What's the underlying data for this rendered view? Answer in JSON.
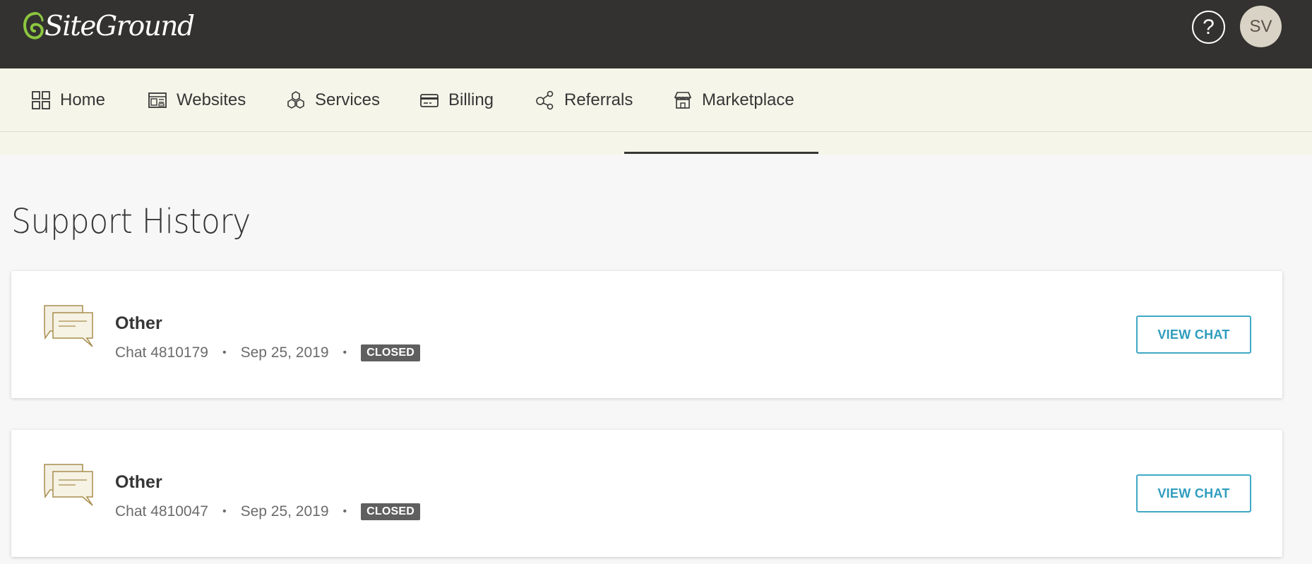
{
  "header": {
    "logo_text": "SiteGround",
    "help_icon": "question-circle-icon",
    "help_label": "?",
    "avatar_initials": "SV"
  },
  "nav": {
    "items": [
      {
        "label": "Home",
        "icon": "grid-icon"
      },
      {
        "label": "Websites",
        "icon": "website-icon"
      },
      {
        "label": "Services",
        "icon": "services-icon"
      },
      {
        "label": "Billing",
        "icon": "credit-card-icon"
      },
      {
        "label": "Referrals",
        "icon": "share-icon"
      },
      {
        "label": "Marketplace",
        "icon": "store-icon"
      }
    ]
  },
  "page": {
    "title": "Support History"
  },
  "chats": [
    {
      "title": "Other",
      "chat_id": "Chat 4810179",
      "date": "Sep 25, 2019",
      "status": "CLOSED",
      "action": "VIEW CHAT"
    },
    {
      "title": "Other",
      "chat_id": "Chat 4810047",
      "date": "Sep 25, 2019",
      "status": "CLOSED",
      "action": "VIEW CHAT"
    }
  ],
  "colors": {
    "topbar": "#333230",
    "nav_bg": "#f5f5e9",
    "accent": "#3fa8c6",
    "logo_green": "#8cc63f",
    "badge": "#5f5f5f"
  }
}
